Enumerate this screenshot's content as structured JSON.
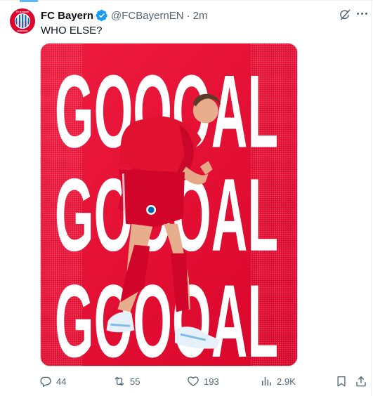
{
  "tweet": {
    "author_name": "FC Bayern",
    "handle": "@FCBayernEN",
    "separator": "·",
    "time": "2m",
    "text": "WHO ELSE?"
  },
  "media": {
    "poster_lines": [
      "GOOOAL",
      "GOOOAL",
      "GOOOAL"
    ],
    "avatar_logo_text": "FC BAYERN MÜNCHEN"
  },
  "actions": {
    "replies": "44",
    "reposts": "55",
    "likes": "193",
    "views": "2.9K"
  },
  "icons": {
    "verified": "verified-badge-icon",
    "grok": "grok-icon",
    "more": "more-icon",
    "reply": "reply-icon",
    "repost": "repost-icon",
    "like": "like-icon",
    "views": "views-icon",
    "bookmark": "bookmark-icon",
    "share": "share-icon"
  },
  "colors": {
    "brand_red": "#dc052d",
    "verified_blue": "#1d9bf0",
    "muted_text": "#536471"
  }
}
